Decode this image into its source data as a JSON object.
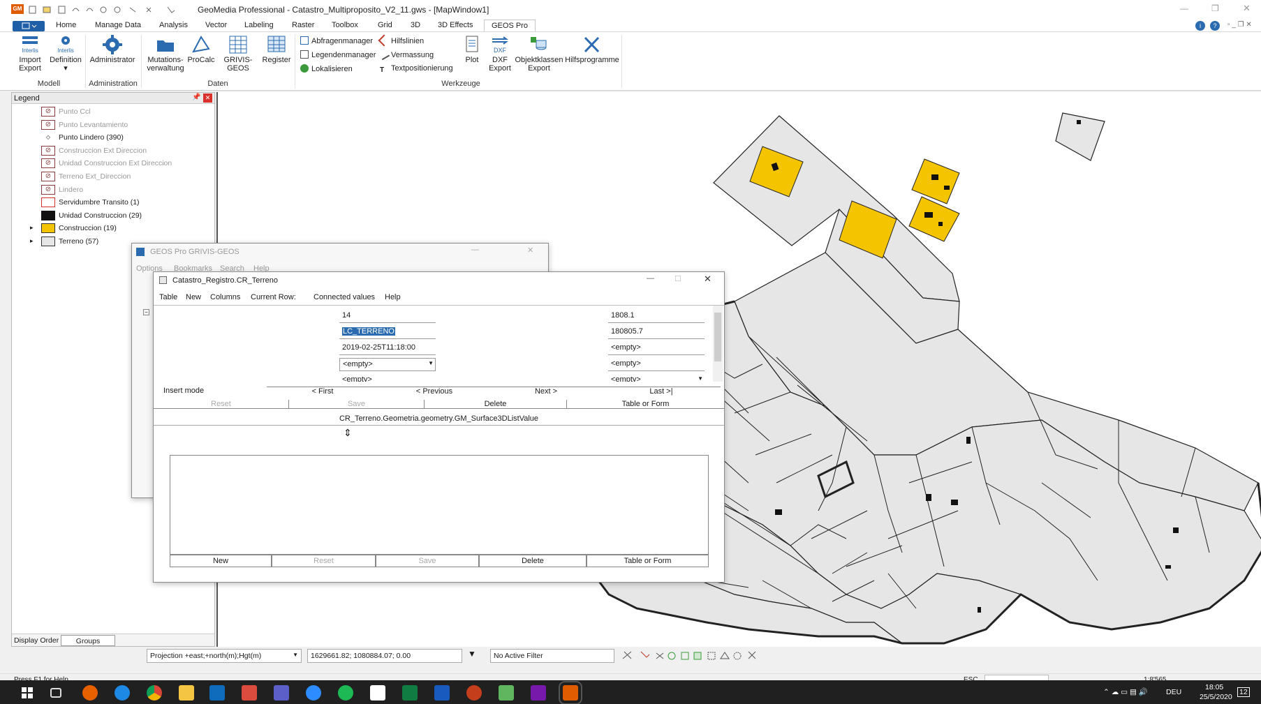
{
  "title_bar": {
    "app_badge": "GM",
    "text": "GeoMedia Professional - Catastro_Multiproposito_V2_11.gws - [MapWindow1]"
  },
  "menu_tabs": [
    "Home",
    "Manage Data",
    "Analysis",
    "Vector",
    "Labeling",
    "Raster",
    "Toolbox",
    "Grid",
    "3D",
    "3D Effects",
    "GEOS Pro"
  ],
  "ribbon": {
    "buttons": [
      {
        "line1": "Import",
        "line2": "Export",
        "icon": "interlis-import-icon",
        "top": "Interlis"
      },
      {
        "line1": "Definition",
        "line2": "▾",
        "icon": "interlis-definition-icon",
        "top": "Interlis"
      },
      {
        "line1": "Administrator",
        "line2": "",
        "icon": "gear-icon"
      },
      {
        "line1": "Mutations-",
        "line2": "verwaltung",
        "icon": "folder-icon"
      },
      {
        "line1": "ProCalc",
        "line2": "",
        "icon": "procalc-icon"
      },
      {
        "line1": "GRIVIS-GEOS",
        "line2": "",
        "icon": "table-icon"
      },
      {
        "line1": "Register",
        "line2": "",
        "icon": "register-icon"
      }
    ],
    "groups": [
      "Modell",
      "Administration",
      "Daten",
      "Werkzeuge"
    ],
    "small": [
      "Abfragenmanager",
      "Legendenmanager",
      "Lokalisieren",
      "Hilfslinien",
      "Vermassung",
      "Textpositionierung"
    ],
    "big2": [
      {
        "line1": "Plot",
        "line2": ""
      },
      {
        "line1": "DXF",
        "line2": "Export"
      },
      {
        "line1": "Objektklassen",
        "line2": "Export"
      },
      {
        "line1": "Hilfsprogramme",
        "line2": ""
      }
    ]
  },
  "legend": {
    "title": "Legend",
    "items": [
      {
        "label": "Punto Ccl",
        "style": "disabled"
      },
      {
        "label": "Punto Levantamiento",
        "style": "disabled"
      },
      {
        "label": "Punto Lindero (390)",
        "style": "point"
      },
      {
        "label": "Construccion Ext Direccion",
        "style": "disabled"
      },
      {
        "label": "Unidad Construccion Ext Direccion",
        "style": "disabled"
      },
      {
        "label": "Terreno Ext_Direccion",
        "style": "disabled"
      },
      {
        "label": "Lindero",
        "style": "disabled"
      },
      {
        "label": "Servidumbre Transito (1)",
        "style": "red"
      },
      {
        "label": "Unidad Construccion (29)",
        "style": "black"
      },
      {
        "label": "Construccion (19)",
        "style": "yellow"
      },
      {
        "label": "Terreno (57)",
        "style": "grey"
      }
    ],
    "tabs": [
      "Display Order",
      "Groups"
    ]
  },
  "grivis": {
    "title": "GEOS Pro GRIVIS-GEOS",
    "menu": [
      "Options",
      "Bookmarks",
      "Search",
      "Help"
    ]
  },
  "form": {
    "title": "Catastro_Registro.CR_Terreno",
    "menu": [
      "Table",
      "New",
      "Columns",
      "Current Row:",
      "Connected values",
      "Help"
    ],
    "left_fields": [
      "14",
      "LC_TERRENO",
      "2019-02-25T11:18:00",
      "<empty>",
      "<empty>"
    ],
    "right_fields": [
      "1808.1",
      "180805.7",
      "<empty>",
      "<empty>",
      "<empty>"
    ],
    "mode": "Insert mode",
    "nav": [
      "< First",
      "< Previous",
      "Next >",
      "Last >|"
    ],
    "actions": [
      "Reset",
      "Save",
      "Delete",
      "Table or Form"
    ],
    "sub_caption": "CR_Terreno.Geometria.geometry.GM_Surface3DListValue",
    "sub_actions": [
      "New",
      "Reset",
      "Save",
      "Delete",
      "Table or Form"
    ]
  },
  "statusbar": {
    "projection": "Projection +east;+north(m);Hgt(m)",
    "coords": "1629661.82; 1080884.07; 0.00",
    "filter": "No Active Filter",
    "help": "Press F1 for Help.",
    "esc": "ESC",
    "scale": "1:8'565"
  },
  "taskbar": {
    "lang": "DEU",
    "time": "18:05",
    "date": "25/5/2020",
    "notif": "12"
  },
  "colors": {
    "accent": "#2b6cb0",
    "yellow": "#f5c400",
    "parcel": "#e6e6e6",
    "taskbar": "#202020"
  }
}
